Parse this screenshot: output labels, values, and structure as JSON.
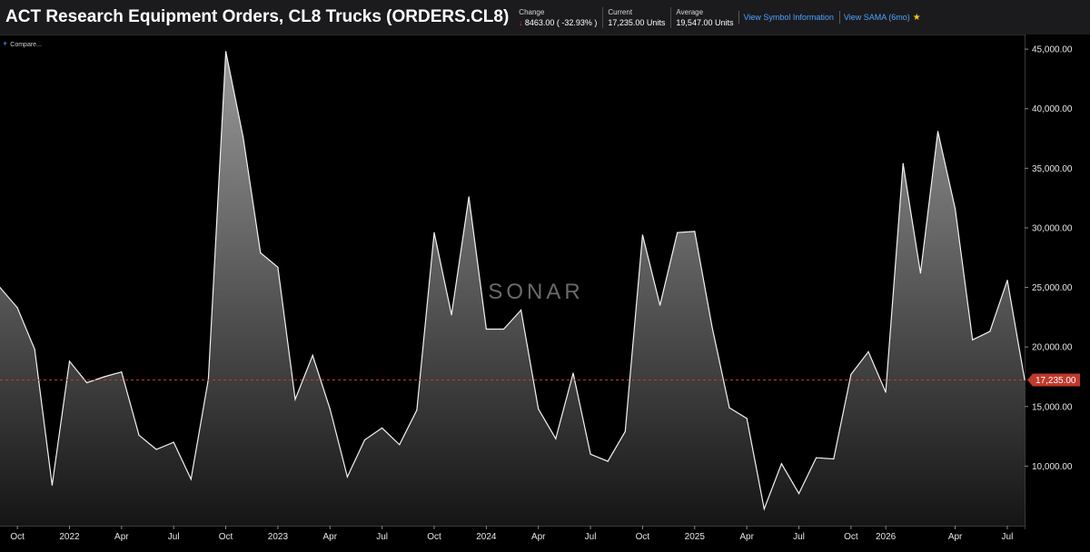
{
  "header": {
    "title": "ACT Research Equipment Orders, CL8 Trucks (ORDERS.CL8)",
    "change": {
      "label": "Change",
      "arrow": "↓",
      "value": "8463.00 ( -32.93% )"
    },
    "current": {
      "label": "Current",
      "value": "17,235.00 Units"
    },
    "average": {
      "label": "Average",
      "value": "19,547.00 Units"
    },
    "link_symbol": "View Symbol Information",
    "link_sama": "View SAMA (6mo)"
  },
  "compare": {
    "icon": "plus-icon",
    "label": "Compare..."
  },
  "colors": {
    "accent_link": "#4da3ff",
    "current_tag": "#c0392b",
    "down": "#e0413a"
  },
  "chart_data": {
    "type": "area",
    "watermark": "SONAR",
    "current_value_label": "17,235.00",
    "current_value": 17235,
    "ylim": [
      5000,
      46000
    ],
    "y_ticks": [
      10000,
      15000,
      20000,
      25000,
      30000,
      35000,
      40000,
      45000
    ],
    "y_tick_labels": [
      "10,000.00",
      "15,000.00",
      "20,000.00",
      "25,000.00",
      "30,000.00",
      "35,000.00",
      "40,000.00",
      "45,000.00"
    ],
    "x_tick_labels": [
      {
        "index": 1,
        "label": "Oct"
      },
      {
        "index": 4,
        "label": "2022"
      },
      {
        "index": 7,
        "label": "Apr"
      },
      {
        "index": 10,
        "label": "Jul"
      },
      {
        "index": 13,
        "label": "Oct"
      },
      {
        "index": 16,
        "label": "2023"
      },
      {
        "index": 19,
        "label": "Apr"
      },
      {
        "index": 22,
        "label": "Jul"
      },
      {
        "index": 25,
        "label": "Oct"
      },
      {
        "index": 28,
        "label": "2024"
      },
      {
        "index": 31,
        "label": "Apr"
      },
      {
        "index": 34,
        "label": "Jul"
      },
      {
        "index": 37,
        "label": "Oct"
      },
      {
        "index": 40,
        "label": "2025"
      },
      {
        "index": 43,
        "label": "Apr"
      },
      {
        "index": 46,
        "label": "Jul"
      },
      {
        "index": 49,
        "label": "Oct"
      },
      {
        "index": 51,
        "label": "2026"
      },
      {
        "index": 55,
        "label": "Apr"
      },
      {
        "index": 58,
        "label": "Jul"
      }
    ],
    "series": [
      {
        "values": [
          25000,
          23300,
          19800,
          8400,
          18800,
          17000,
          17500,
          17900,
          12600,
          11400,
          12000,
          8900,
          17300,
          44800,
          37600,
          27900,
          26700,
          15600,
          19300,
          14800,
          9100,
          12200,
          13200,
          11800,
          14700,
          29600,
          22700,
          32600,
          21500,
          21500,
          23100,
          14800,
          12300,
          17800,
          11000,
          10400,
          12900,
          29400,
          23500,
          29600,
          29700,
          21700,
          14900,
          14000,
          6400,
          10200,
          7700,
          10700,
          10600,
          17700,
          19600,
          16200,
          35400,
          26200,
          38100,
          31600,
          20600,
          21300,
          25600,
          17235
        ]
      }
    ]
  }
}
